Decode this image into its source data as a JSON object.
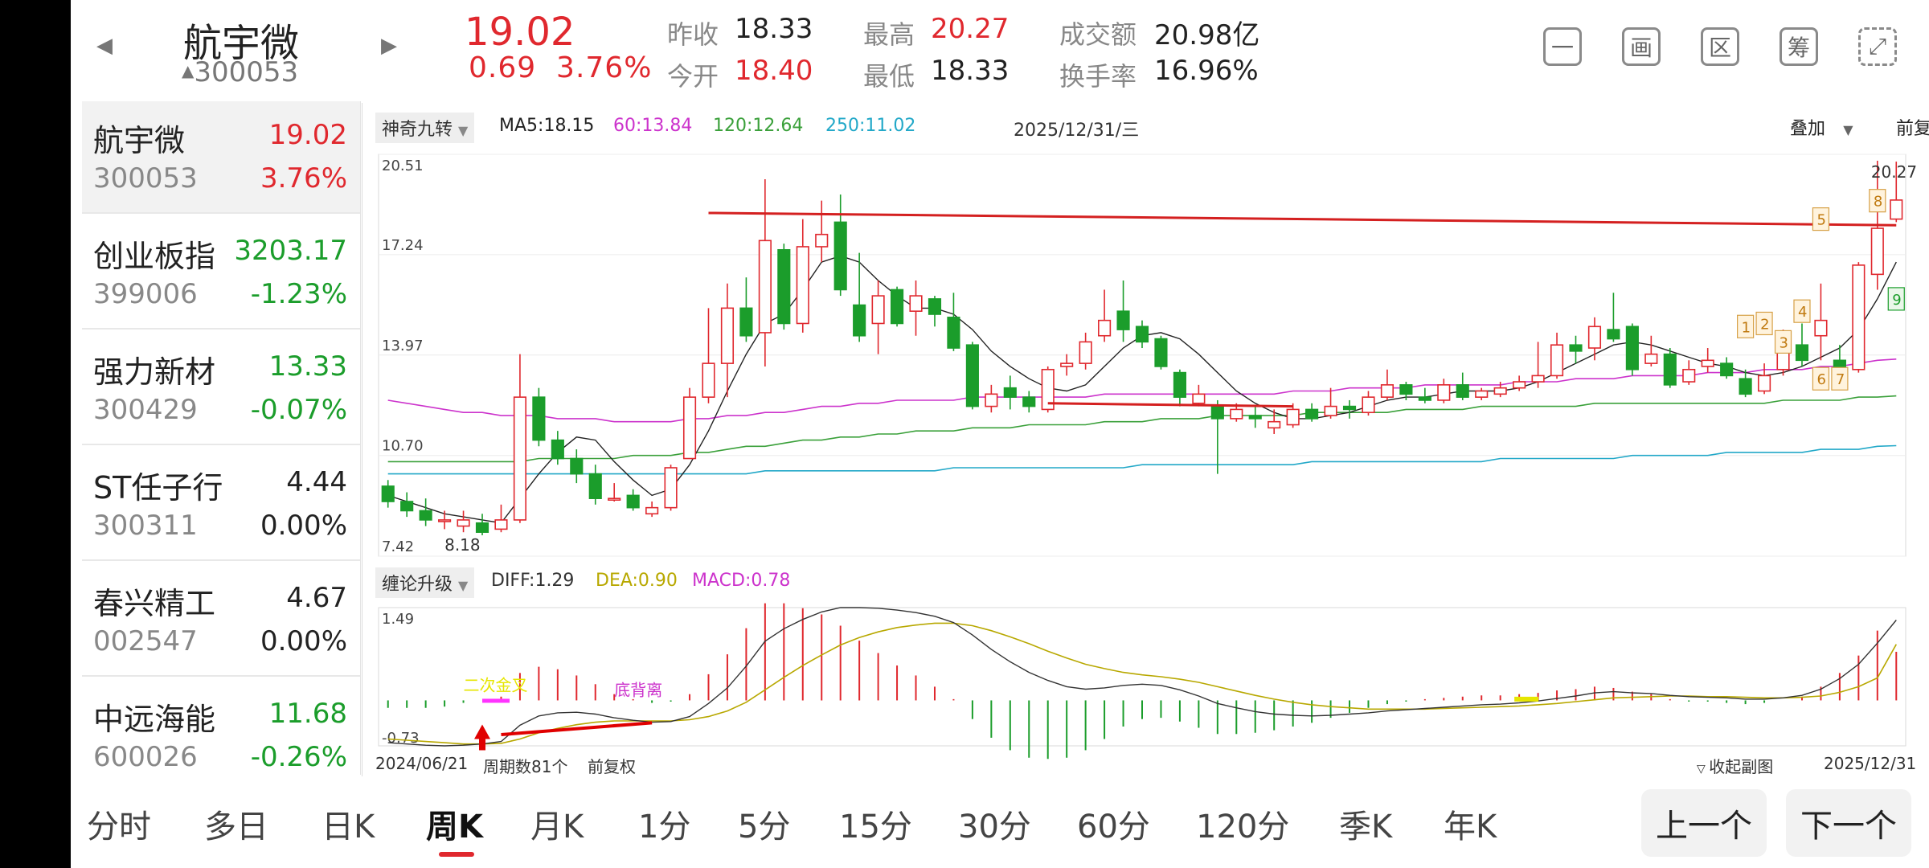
{
  "header": {
    "name": "航宇微",
    "code_prefix": "▲",
    "code": "300053",
    "price": "19.02",
    "change": "0.69",
    "change_pct": "3.76%",
    "prev_close_label": "昨收",
    "prev_close": "18.33",
    "open_label": "今开",
    "open": "18.40",
    "high_label": "最高",
    "high": "20.27",
    "low_label": "最低",
    "low": "18.33",
    "turnover_label": "成交额",
    "turnover": "20.98亿",
    "turnover_rate_label": "换手率",
    "turnover_rate": "16.96%",
    "left_arrow": "◀",
    "right_arrow": "▶",
    "tools": [
      {
        "icon": "minus-box-icon",
        "glyph": "一"
      },
      {
        "icon": "board-icon",
        "glyph": "画"
      },
      {
        "icon": "area-icon",
        "glyph": "区"
      },
      {
        "icon": "chip-icon",
        "glyph": "筹"
      },
      {
        "icon": "rotate-screen-icon",
        "glyph": "⤢"
      }
    ]
  },
  "watchlist": [
    {
      "name": "航宇微",
      "code": "300053",
      "price": "19.02",
      "pct": "3.76%",
      "color": "red"
    },
    {
      "name": "创业板指",
      "code": "399006",
      "price": "3203.17",
      "pct": "-1.23%",
      "color": "green"
    },
    {
      "name": "强力新材",
      "code": "300429",
      "price": "13.33",
      "pct": "-0.07%",
      "color": "green"
    },
    {
      "name": "ST任子行",
      "code": "300311",
      "price": "4.44",
      "pct": "0.00%",
      "color": "dark"
    },
    {
      "name": "春兴精工",
      "code": "002547",
      "price": "4.67",
      "pct": "0.00%",
      "color": "dark"
    },
    {
      "name": "中远海能",
      "code": "600026",
      "price": "11.68",
      "pct": "-0.26%",
      "color": "green"
    }
  ],
  "chart": {
    "indicator_tag": "神奇九转",
    "ma5": "MA5:18.15",
    "ma60": "60:13.84",
    "ma120": "120:12.64",
    "ma250": "250:11.02",
    "date_label": "2025/12/31/三",
    "overlay": "叠加",
    "adjust": "前复权",
    "y_labels": [
      "20.51",
      "17.24",
      "13.97",
      "10.70",
      "7.42"
    ],
    "high_mark": "20.27",
    "low_mark": "8.18",
    "sub_tag": "缠论升级",
    "diff": "DIFF:1.29",
    "dea": "DEA:0.90",
    "macd": "MACD:0.78",
    "sub_top": "1.49",
    "sub_bottom": "-0.73",
    "ann_cross": "二次金叉",
    "ann_div": "底背离",
    "date_start": "2024/06/21",
    "periods": "周期数81个",
    "adjust_small": "前复权",
    "collapse": "收起副图",
    "date_end": "2025/12/31",
    "nine_labels": [
      "1",
      "2",
      "3",
      "4",
      "5",
      "6",
      "7",
      "8",
      "9"
    ],
    "colors": {
      "up": "#e0282e",
      "down": "#1b9d2b",
      "ma5": "#222222",
      "ma60": "#cc33cc",
      "ma120": "#3aa03a",
      "ma250": "#22a8c8",
      "dea": "#b8a800"
    }
  },
  "chart_data": {
    "type": "candlestick",
    "title": "",
    "xlabel": "",
    "ylabel": "",
    "ylim": [
      7.42,
      20.51
    ],
    "candles": [
      [
        9.7,
        9.2,
        9.9,
        9.0
      ],
      [
        9.2,
        8.9,
        9.5,
        8.7
      ],
      [
        8.9,
        8.6,
        9.3,
        8.4
      ],
      [
        8.6,
        8.6,
        8.9,
        8.3
      ],
      [
        8.4,
        8.6,
        8.9,
        8.2
      ],
      [
        8.5,
        8.2,
        8.8,
        8.1
      ],
      [
        8.3,
        8.6,
        9.1,
        8.2
      ],
      [
        8.6,
        12.6,
        14.0,
        8.5
      ],
      [
        12.6,
        11.2,
        12.9,
        11.0
      ],
      [
        11.2,
        10.6,
        11.5,
        10.4
      ],
      [
        10.6,
        10.1,
        10.9,
        9.8
      ],
      [
        10.1,
        9.3,
        10.4,
        9.1
      ],
      [
        9.3,
        9.3,
        9.8,
        9.2
      ],
      [
        9.4,
        9.0,
        9.6,
        8.9
      ],
      [
        8.8,
        9.0,
        9.2,
        8.7
      ],
      [
        9.0,
        10.3,
        10.4,
        8.9
      ],
      [
        10.6,
        12.6,
        12.9,
        10.6
      ],
      [
        12.6,
        13.7,
        15.5,
        12.4
      ],
      [
        13.7,
        15.5,
        16.3,
        12.6
      ],
      [
        15.5,
        14.6,
        16.5,
        14.4
      ],
      [
        14.7,
        17.7,
        19.7,
        13.6
      ],
      [
        17.4,
        15.0,
        17.6,
        14.8
      ],
      [
        15.0,
        17.5,
        18.4,
        14.7
      ],
      [
        17.5,
        17.9,
        19.0,
        17.0
      ],
      [
        18.3,
        16.1,
        19.2,
        15.9
      ],
      [
        15.6,
        14.6,
        17.3,
        14.4
      ],
      [
        15.0,
        15.9,
        16.4,
        14.0
      ],
      [
        16.1,
        15.0,
        16.2,
        14.9
      ],
      [
        15.4,
        15.9,
        16.4,
        14.6
      ],
      [
        15.8,
        15.3,
        15.9,
        14.9
      ],
      [
        15.2,
        14.2,
        16.0,
        14.1
      ],
      [
        14.3,
        12.3,
        14.4,
        12.2
      ],
      [
        12.3,
        12.7,
        13.0,
        12.1
      ],
      [
        12.9,
        12.6,
        13.3,
        12.2
      ],
      [
        12.6,
        12.3,
        12.8,
        12.1
      ],
      [
        12.2,
        13.5,
        13.6,
        12.1
      ],
      [
        13.6,
        13.7,
        14.0,
        13.3
      ],
      [
        13.7,
        14.4,
        14.7,
        13.5
      ],
      [
        14.6,
        15.1,
        16.1,
        14.4
      ],
      [
        15.4,
        14.8,
        16.4,
        14.4
      ],
      [
        14.9,
        14.4,
        15.1,
        14.2
      ],
      [
        14.5,
        13.6,
        14.6,
        13.5
      ],
      [
        13.4,
        12.6,
        13.5,
        12.3
      ],
      [
        12.4,
        12.7,
        13.0,
        12.3
      ],
      [
        12.3,
        11.9,
        12.5,
        10.1
      ],
      [
        11.9,
        12.2,
        12.4,
        11.8
      ],
      [
        12.0,
        11.9,
        12.3,
        11.6
      ],
      [
        11.6,
        11.8,
        12.2,
        11.4
      ],
      [
        11.7,
        12.2,
        12.4,
        11.6
      ],
      [
        12.2,
        11.9,
        12.4,
        11.8
      ],
      [
        12.0,
        12.3,
        12.9,
        11.9
      ],
      [
        12.3,
        12.2,
        12.5,
        11.9
      ],
      [
        12.1,
        12.6,
        12.8,
        12.0
      ],
      [
        12.6,
        13.0,
        13.5,
        12.5
      ],
      [
        13.0,
        12.7,
        13.1,
        12.5
      ],
      [
        12.6,
        12.5,
        12.9,
        12.4
      ],
      [
        12.5,
        13.0,
        13.2,
        12.4
      ],
      [
        13.0,
        12.6,
        13.4,
        12.5
      ],
      [
        12.6,
        12.8,
        12.9,
        12.5
      ],
      [
        12.7,
        12.9,
        13.1,
        12.6
      ],
      [
        12.9,
        13.1,
        13.3,
        12.8
      ],
      [
        13.1,
        13.3,
        14.4,
        12.9
      ],
      [
        13.3,
        14.3,
        14.7,
        13.2
      ],
      [
        14.3,
        14.1,
        14.6,
        13.7
      ],
      [
        14.2,
        14.9,
        15.2,
        13.8
      ],
      [
        14.8,
        14.5,
        16.0,
        14.4
      ],
      [
        14.9,
        13.5,
        15.0,
        13.3
      ],
      [
        13.7,
        14.0,
        14.6,
        13.6
      ],
      [
        14.0,
        13.0,
        14.2,
        12.9
      ],
      [
        13.1,
        13.5,
        13.8,
        13.0
      ],
      [
        13.6,
        13.8,
        14.2,
        13.4
      ],
      [
        13.7,
        13.3,
        13.9,
        13.2
      ],
      [
        13.2,
        12.7,
        13.5,
        12.6
      ],
      [
        12.8,
        13.3,
        13.7,
        12.7
      ],
      [
        13.5,
        14.6,
        14.8,
        13.3
      ],
      [
        14.3,
        13.8,
        15.0,
        13.6
      ],
      [
        14.6,
        15.1,
        16.3,
        13.8
      ],
      [
        13.8,
        13.5,
        14.3,
        13.2
      ],
      [
        13.5,
        16.9,
        17.0,
        13.4
      ],
      [
        16.6,
        18.1,
        20.3,
        16.1
      ],
      [
        18.4,
        19.02,
        20.27,
        18.3
      ]
    ],
    "ma5": [
      9.4,
      9.2,
      9.0,
      8.8,
      8.7,
      8.6,
      8.5,
      9.3,
      10.1,
      10.8,
      11.3,
      11.2,
      10.5,
      9.9,
      9.4,
      9.6,
      10.4,
      11.5,
      12.8,
      14.0,
      15.0,
      15.3,
      16.1,
      17.0,
      17.2,
      17.0,
      16.4,
      15.9,
      15.5,
      15.5,
      15.3,
      14.8,
      14.1,
      13.6,
      13.2,
      12.9,
      12.8,
      13.0,
      13.6,
      14.2,
      14.6,
      14.7,
      14.5,
      14.0,
      13.4,
      12.8,
      12.4,
      12.1,
      11.9,
      11.9,
      12.0,
      12.1,
      12.3,
      12.5,
      12.6,
      12.6,
      12.7,
      12.8,
      12.8,
      12.8,
      12.9,
      13.1,
      13.4,
      13.7,
      14.0,
      14.3,
      14.4,
      14.3,
      14.1,
      13.9,
      13.7,
      13.6,
      13.4,
      13.3,
      13.4,
      13.6,
      13.9,
      14.2,
      14.8,
      15.8,
      17.0
    ],
    "ma60": [
      12.5,
      12.4,
      12.3,
      12.2,
      12.1,
      12.1,
      12.0,
      12.0,
      12.0,
      11.9,
      11.9,
      11.9,
      11.8,
      11.8,
      11.8,
      11.8,
      11.9,
      11.9,
      12.0,
      12.0,
      12.1,
      12.1,
      12.2,
      12.3,
      12.3,
      12.4,
      12.4,
      12.5,
      12.5,
      12.5,
      12.5,
      12.6,
      12.6,
      12.6,
      12.6,
      12.6,
      12.6,
      12.6,
      12.7,
      12.7,
      12.7,
      12.7,
      12.7,
      12.7,
      12.7,
      12.7,
      12.7,
      12.7,
      12.8,
      12.8,
      12.8,
      12.9,
      12.9,
      12.9,
      12.9,
      13.0,
      13.0,
      13.0,
      13.0,
      13.0,
      13.1,
      13.1,
      13.1,
      13.2,
      13.2,
      13.2,
      13.3,
      13.3,
      13.3,
      13.3,
      13.4,
      13.4,
      13.4,
      13.5,
      13.5,
      13.5,
      13.6,
      13.6,
      13.7,
      13.8,
      13.84
    ],
    "ma120": [
      10.5,
      10.5,
      10.5,
      10.5,
      10.5,
      10.5,
      10.5,
      10.5,
      10.6,
      10.6,
      10.6,
      10.6,
      10.6,
      10.7,
      10.7,
      10.7,
      10.8,
      10.8,
      10.9,
      11.0,
      11.0,
      11.1,
      11.2,
      11.2,
      11.3,
      11.3,
      11.4,
      11.4,
      11.5,
      11.5,
      11.5,
      11.6,
      11.6,
      11.6,
      11.7,
      11.7,
      11.7,
      11.7,
      11.8,
      11.8,
      11.8,
      11.9,
      11.9,
      11.9,
      12.0,
      12.0,
      12.0,
      12.0,
      12.0,
      12.1,
      12.1,
      12.1,
      12.1,
      12.1,
      12.2,
      12.2,
      12.2,
      12.2,
      12.3,
      12.3,
      12.3,
      12.3,
      12.3,
      12.3,
      12.4,
      12.4,
      12.4,
      12.4,
      12.4,
      12.4,
      12.4,
      12.4,
      12.4,
      12.4,
      12.5,
      12.5,
      12.5,
      12.5,
      12.6,
      12.6,
      12.64
    ],
    "ma250": [
      10.1,
      10.1,
      10.1,
      10.1,
      10.1,
      10.1,
      10.1,
      10.1,
      10.1,
      10.1,
      10.1,
      10.1,
      10.1,
      10.1,
      10.1,
      10.1,
      10.1,
      10.1,
      10.1,
      10.1,
      10.2,
      10.2,
      10.2,
      10.2,
      10.2,
      10.2,
      10.2,
      10.2,
      10.2,
      10.2,
      10.3,
      10.3,
      10.3,
      10.3,
      10.3,
      10.3,
      10.3,
      10.3,
      10.3,
      10.3,
      10.4,
      10.4,
      10.4,
      10.4,
      10.4,
      10.4,
      10.4,
      10.4,
      10.4,
      10.5,
      10.5,
      10.5,
      10.5,
      10.5,
      10.5,
      10.5,
      10.5,
      10.5,
      10.5,
      10.6,
      10.6,
      10.6,
      10.6,
      10.6,
      10.6,
      10.6,
      10.7,
      10.7,
      10.7,
      10.7,
      10.7,
      10.8,
      10.8,
      10.8,
      10.8,
      10.8,
      10.9,
      10.9,
      10.9,
      11.0,
      11.02
    ],
    "diff": [
      -0.68,
      -0.7,
      -0.72,
      -0.73,
      -0.72,
      -0.7,
      -0.66,
      -0.4,
      -0.25,
      -0.2,
      -0.19,
      -0.22,
      -0.28,
      -0.32,
      -0.35,
      -0.34,
      -0.26,
      -0.05,
      0.2,
      0.55,
      0.95,
      1.15,
      1.3,
      1.42,
      1.49,
      1.49,
      1.48,
      1.45,
      1.41,
      1.35,
      1.25,
      1.05,
      0.82,
      0.62,
      0.45,
      0.32,
      0.22,
      0.18,
      0.2,
      0.24,
      0.26,
      0.24,
      0.17,
      0.07,
      -0.05,
      -0.12,
      -0.18,
      -0.22,
      -0.24,
      -0.25,
      -0.24,
      -0.22,
      -0.2,
      -0.17,
      -0.15,
      -0.13,
      -0.11,
      -0.09,
      -0.07,
      -0.06,
      -0.04,
      -0.01,
      0.03,
      0.07,
      0.12,
      0.14,
      0.12,
      0.11,
      0.08,
      0.06,
      0.05,
      0.04,
      0.02,
      0.02,
      0.04,
      0.08,
      0.18,
      0.35,
      0.58,
      0.92,
      1.29
    ],
    "dea": [
      -0.62,
      -0.64,
      -0.66,
      -0.68,
      -0.7,
      -0.7,
      -0.69,
      -0.62,
      -0.52,
      -0.45,
      -0.39,
      -0.35,
      -0.33,
      -0.33,
      -0.33,
      -0.33,
      -0.31,
      -0.26,
      -0.17,
      -0.03,
      0.17,
      0.37,
      0.56,
      0.73,
      0.89,
      1.01,
      1.1,
      1.17,
      1.21,
      1.24,
      1.24,
      1.2,
      1.12,
      1.02,
      0.91,
      0.79,
      0.68,
      0.58,
      0.51,
      0.45,
      0.41,
      0.38,
      0.34,
      0.29,
      0.22,
      0.15,
      0.08,
      0.02,
      -0.03,
      -0.07,
      -0.1,
      -0.12,
      -0.14,
      -0.14,
      -0.14,
      -0.14,
      -0.13,
      -0.12,
      -0.11,
      -0.1,
      -0.09,
      -0.07,
      -0.05,
      -0.02,
      0.01,
      0.04,
      0.05,
      0.06,
      0.07,
      0.07,
      0.06,
      0.06,
      0.05,
      0.04,
      0.04,
      0.05,
      0.07,
      0.13,
      0.22,
      0.36,
      0.9
    ]
  }
}
